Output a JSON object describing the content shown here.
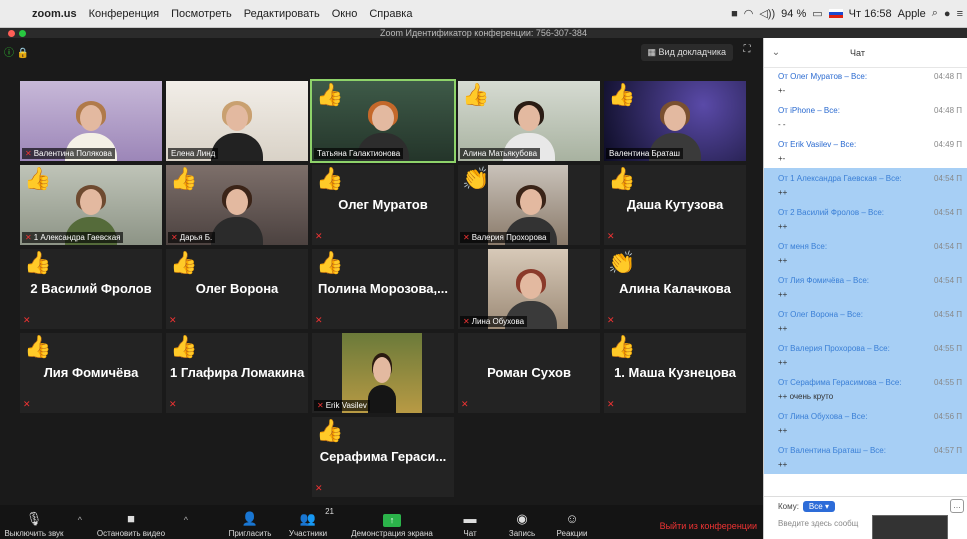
{
  "menubar": {
    "app": "zoom.us",
    "items": [
      "Конференция",
      "Посмотреть",
      "Редактировать",
      "Окно",
      "Справка"
    ],
    "battery": "94 %",
    "clock": "Чт 16:58",
    "apple_id": "Apple"
  },
  "window": {
    "title": "Zoom Идентификатор конференции: 756-307-384"
  },
  "video": {
    "speaker_view": "Вид докладчика",
    "tiles": [
      {
        "name": "Валентина Полякова"
      },
      {
        "name": "Елена Линд"
      },
      {
        "name": "Татьяна Галактионова"
      },
      {
        "name": "Алина Матьякубова"
      },
      {
        "name": "Валентина Браташ"
      },
      {
        "name": "1 Александра Гаевская"
      },
      {
        "name": "Дарья Б."
      },
      {
        "name": "Олег Муратов"
      },
      {
        "name": "Валерия Прохорова"
      },
      {
        "name": "Даша Кутузова"
      },
      {
        "name": "2 Василий Фролов"
      },
      {
        "name": "Олег Ворона"
      },
      {
        "name": "Полина Морозова,..."
      },
      {
        "name": "Лина Обухова"
      },
      {
        "name": "Алина Калачкова"
      },
      {
        "name": "Лия Фомичёва"
      },
      {
        "name": "1 Глафира Ломакина"
      },
      {
        "name": "Erik Vasilev"
      },
      {
        "name": "Роман Сухов"
      },
      {
        "name": "1. Маша Кузнецова"
      },
      {
        "name": "Серафима Гераси..."
      }
    ]
  },
  "controls": {
    "mute": "Выключить звук",
    "video": "Остановить видео",
    "invite": "Пригласить",
    "participants": "Участники",
    "participants_count": "21",
    "share": "Демонстрация экрана",
    "chat": "Чат",
    "record": "Запись",
    "reactions": "Реакции",
    "leave": "Выйти из конференции"
  },
  "chat": {
    "title": "Чат",
    "messages": [
      {
        "from": "От Олег Муратов – Все:",
        "time": "04:48 П",
        "text": "+-"
      },
      {
        "from": "От iPhone – Все:",
        "time": "04:48 П",
        "text": "- -"
      },
      {
        "from": "От Erik Vasilev – Все:",
        "time": "04:49 П",
        "text": "+-"
      },
      {
        "from": "От 1 Александра Гаевская – Все:",
        "time": "04:54 П",
        "text": "++"
      },
      {
        "from": "От 2 Василий Фролов – Все:",
        "time": "04:54 П",
        "text": "++"
      },
      {
        "from": "От меня Все:",
        "time": "04:54 П",
        "text": "++"
      },
      {
        "from": "От Лия Фомичёва – Все:",
        "time": "04:54 П",
        "text": "++"
      },
      {
        "from": "От Олег Ворона  – Все:",
        "time": "04:54 П",
        "text": "++"
      },
      {
        "from": "От Валерия Прохорова – Все:",
        "time": "04:55 П",
        "text": "++"
      },
      {
        "from": "От Серафима Герасимова – Все:",
        "time": "04:55 П",
        "text": "++ очень круто"
      },
      {
        "from": "От Лина Обухова – Все:",
        "time": "04:56 П",
        "text": "++"
      },
      {
        "from": "От Валентина Браташ – Все:",
        "time": "04:57 П",
        "text": "++"
      }
    ],
    "to_label": "Кому:",
    "to_value": "Все",
    "input_placeholder": "Введите здесь сообщ"
  },
  "colors": {
    "accent": "#2d6cd8",
    "active_speaker": "#8ed36a",
    "leave": "#e33333",
    "share": "#2bb34a"
  }
}
